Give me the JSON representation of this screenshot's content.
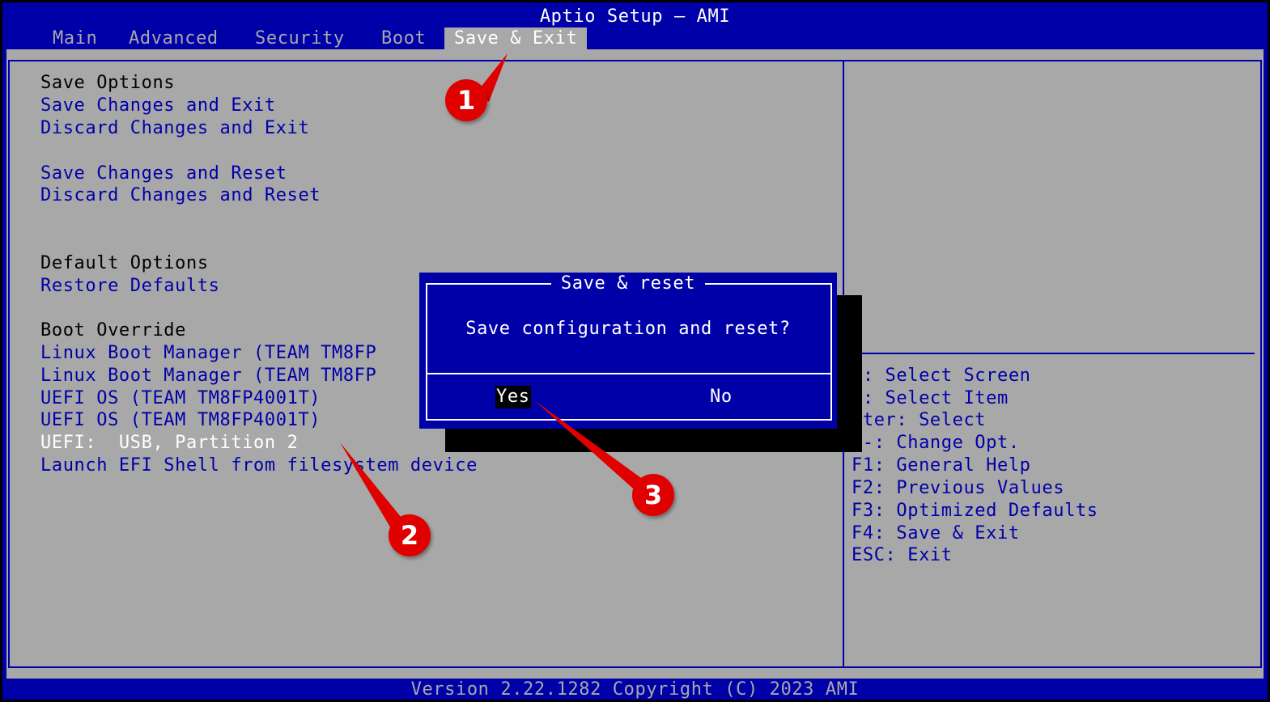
{
  "header": {
    "title": "Aptio Setup – AMI"
  },
  "tabs": [
    {
      "label": "Main"
    },
    {
      "label": "Advanced"
    },
    {
      "label": "Security"
    },
    {
      "label": "Boot"
    },
    {
      "label": "Save & Exit",
      "active": true
    }
  ],
  "menu": {
    "save_options_header": "Save Options",
    "save_changes_exit": "Save Changes and Exit",
    "discard_changes_exit": "Discard Changes and Exit",
    "save_changes_reset": "Save Changes and Reset",
    "discard_changes_reset": "Discard Changes and Reset",
    "default_options_header": "Default Options",
    "restore_defaults": "Restore Defaults",
    "boot_override_header": "Boot Override",
    "boot_items": [
      "Linux Boot Manager (TEAM TM8FP",
      "Linux Boot Manager (TEAM TM8FP",
      "UEFI OS (TEAM TM8FP4001T)",
      "UEFI OS (TEAM TM8FP4001T)",
      "UEFI:  USB, Partition 2",
      "Launch EFI Shell from filesystem device"
    ]
  },
  "help": {
    "lines": [
      "←: Select Screen",
      "↓: Select Item",
      "nter: Select",
      "/-: Change Opt.",
      "F1: General Help",
      "F2: Previous Values",
      "F3: Optimized Defaults",
      "F4: Save & Exit",
      "ESC: Exit"
    ]
  },
  "dialog": {
    "title": "Save & reset",
    "message": "Save configuration and reset?",
    "yes_label": "Yes",
    "no_label": "No"
  },
  "footer": {
    "version": "Version 2.22.1282 Copyright (C) 2023 AMI"
  },
  "annotations": {
    "marker_1": "1",
    "marker_2": "2",
    "marker_3": "3"
  },
  "colors": {
    "bios_blue": "#0000A8",
    "bios_gray": "#A8A8A8",
    "marker_red": "#E00000"
  }
}
